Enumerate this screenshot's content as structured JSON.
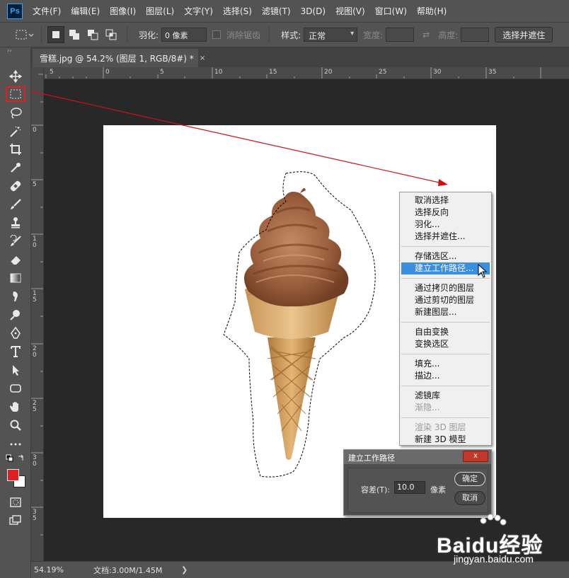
{
  "menubar": {
    "logo": "Ps",
    "items": [
      "文件(F)",
      "编辑(E)",
      "图像(I)",
      "图层(L)",
      "文字(Y)",
      "选择(S)",
      "滤镜(T)",
      "3D(D)",
      "视图(V)",
      "窗口(W)",
      "帮助(H)"
    ]
  },
  "options": {
    "feather_label": "羽化:",
    "feather_value": "0 像素",
    "antialias_label": "消除锯齿",
    "style_label": "样式:",
    "style_value": "正常",
    "width_label": "宽度:",
    "height_label": "高度:",
    "select_mask_label": "选择并遮住"
  },
  "document": {
    "tab_title": "雪糕.jpg @ 54.2% (图层 1, RGB/8#) *",
    "close_glyph": "×"
  },
  "ruler": {
    "top": [
      "5",
      "0",
      "5",
      "10",
      "15",
      "20",
      "25",
      "30",
      "35"
    ],
    "left": [
      "0",
      "5",
      "1 0",
      "1 5",
      "2 0",
      "2 5",
      "3 0",
      "3 5"
    ]
  },
  "context_menu": {
    "groups": [
      [
        {
          "label": "取消选择"
        },
        {
          "label": "选择反向"
        },
        {
          "label": "羽化..."
        },
        {
          "label": "选择并遮住..."
        }
      ],
      [
        {
          "label": "存储选区..."
        },
        {
          "label": "建立工作路径...",
          "highlight": true
        }
      ],
      [
        {
          "label": "通过拷贝的图层"
        },
        {
          "label": "通过剪切的图层"
        },
        {
          "label": "新建图层..."
        }
      ],
      [
        {
          "label": "自由变换"
        },
        {
          "label": "变换选区"
        }
      ],
      [
        {
          "label": "填充..."
        },
        {
          "label": "描边..."
        }
      ],
      [
        {
          "label": "滤镜库"
        },
        {
          "label": "渐隐...",
          "disabled": true
        }
      ],
      [
        {
          "label": "渲染 3D 图层",
          "disabled": true
        },
        {
          "label": "新建 3D 模型"
        }
      ]
    ]
  },
  "dialog": {
    "title": "建立工作路径",
    "close_glyph": "x",
    "tolerance_label": "容差(T):",
    "tolerance_value": "10.0",
    "unit": "像素",
    "ok_label": "确定",
    "cancel_label": "取消"
  },
  "status": {
    "zoom": "54.19%",
    "doc_info": "文档:3.00M/1.45M",
    "arrow": "❯"
  },
  "watermark": {
    "brand": "Baidu经验",
    "url": "jingyan.baidu.com"
  },
  "colors": {
    "foreground": "#e02020",
    "background": "#ffffff",
    "highlight": "#3c8ede",
    "annotation_arrow": "#d01010"
  }
}
